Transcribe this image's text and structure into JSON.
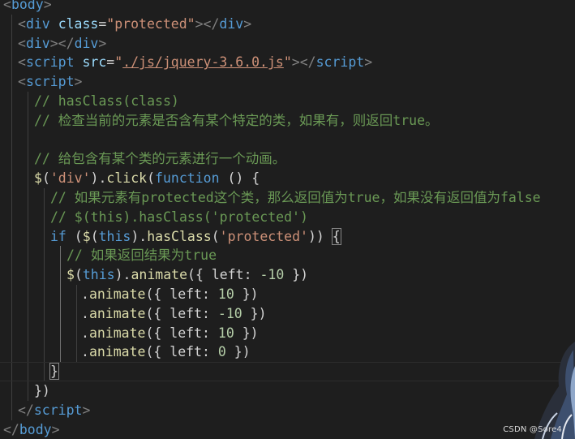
{
  "code": {
    "lines": [
      [
        {
          "c": "punct",
          "t": "<"
        },
        {
          "c": "tag",
          "t": "body"
        },
        {
          "c": "punct",
          "t": ">"
        }
      ],
      [
        {
          "c": "punct",
          "t": "<"
        },
        {
          "c": "tag",
          "t": "div"
        },
        {
          "c": "plain",
          "t": " "
        },
        {
          "c": "attr",
          "t": "class"
        },
        {
          "c": "plain",
          "t": "="
        },
        {
          "c": "str",
          "t": "\"protected\""
        },
        {
          "c": "punct",
          "t": "></"
        },
        {
          "c": "tag",
          "t": "div"
        },
        {
          "c": "punct",
          "t": ">"
        }
      ],
      [
        {
          "c": "punct",
          "t": "<"
        },
        {
          "c": "tag",
          "t": "div"
        },
        {
          "c": "punct",
          "t": "></"
        },
        {
          "c": "tag",
          "t": "div"
        },
        {
          "c": "punct",
          "t": ">"
        }
      ],
      [
        {
          "c": "punct",
          "t": "<"
        },
        {
          "c": "tag",
          "t": "script"
        },
        {
          "c": "plain",
          "t": " "
        },
        {
          "c": "attr",
          "t": "src"
        },
        {
          "c": "plain",
          "t": "="
        },
        {
          "c": "str",
          "t": "\""
        },
        {
          "c": "str link",
          "t": "./js/jquery-3.6.0.js"
        },
        {
          "c": "str",
          "t": "\""
        },
        {
          "c": "punct",
          "t": "></"
        },
        {
          "c": "tag",
          "t": "script"
        },
        {
          "c": "punct",
          "t": ">"
        }
      ],
      [
        {
          "c": "punct",
          "t": "<"
        },
        {
          "c": "tag",
          "t": "script"
        },
        {
          "c": "punct",
          "t": ">"
        }
      ],
      [
        {
          "c": "com",
          "t": "// hasClass(class)"
        }
      ],
      [
        {
          "c": "com",
          "t": "// 检查当前的元素是否含有某个特定的类，如果有，则返回true。"
        }
      ],
      [],
      [
        {
          "c": "com",
          "t": "// 给包含有某个类的元素进行一个动画。"
        }
      ],
      [
        {
          "c": "fn",
          "t": "$"
        },
        {
          "c": "plain",
          "t": "("
        },
        {
          "c": "str",
          "t": "'div'"
        },
        {
          "c": "plain",
          "t": ")."
        },
        {
          "c": "fn",
          "t": "click"
        },
        {
          "c": "plain",
          "t": "("
        },
        {
          "c": "kw",
          "t": "function"
        },
        {
          "c": "plain",
          "t": " () {"
        }
      ],
      [
        {
          "c": "com",
          "t": "// 如果元素有protected这个类，那么返回值为true，如果没有返回值为false"
        }
      ],
      [
        {
          "c": "com",
          "t": "// $(this).hasClass('protected')"
        }
      ],
      [
        {
          "c": "kw",
          "t": "if"
        },
        {
          "c": "plain",
          "t": " ("
        },
        {
          "c": "fn",
          "t": "$"
        },
        {
          "c": "plain",
          "t": "("
        },
        {
          "c": "kw",
          "t": "this"
        },
        {
          "c": "plain",
          "t": ")."
        },
        {
          "c": "fn",
          "t": "hasClass"
        },
        {
          "c": "plain",
          "t": "("
        },
        {
          "c": "str",
          "t": "'protected'"
        },
        {
          "c": "plain",
          "t": ")) "
        },
        {
          "c": "plain bracket-match",
          "t": "{"
        }
      ],
      [
        {
          "c": "com",
          "t": "// 如果返回结果为true"
        }
      ],
      [
        {
          "c": "fn",
          "t": "$"
        },
        {
          "c": "plain",
          "t": "("
        },
        {
          "c": "kw",
          "t": "this"
        },
        {
          "c": "plain",
          "t": ")."
        },
        {
          "c": "fn",
          "t": "animate"
        },
        {
          "c": "plain",
          "t": "({ left: "
        },
        {
          "c": "num",
          "t": "-10"
        },
        {
          "c": "plain",
          "t": " })"
        }
      ],
      [
        {
          "c": "plain",
          "t": "."
        },
        {
          "c": "fn",
          "t": "animate"
        },
        {
          "c": "plain",
          "t": "({ left: "
        },
        {
          "c": "num",
          "t": "10"
        },
        {
          "c": "plain",
          "t": " })"
        }
      ],
      [
        {
          "c": "plain",
          "t": "."
        },
        {
          "c": "fn",
          "t": "animate"
        },
        {
          "c": "plain",
          "t": "({ left: "
        },
        {
          "c": "num",
          "t": "-10"
        },
        {
          "c": "plain",
          "t": " })"
        }
      ],
      [
        {
          "c": "plain",
          "t": "."
        },
        {
          "c": "fn",
          "t": "animate"
        },
        {
          "c": "plain",
          "t": "({ left: "
        },
        {
          "c": "num",
          "t": "10"
        },
        {
          "c": "plain",
          "t": " })"
        }
      ],
      [
        {
          "c": "plain",
          "t": "."
        },
        {
          "c": "fn",
          "t": "animate"
        },
        {
          "c": "plain",
          "t": "({ left: "
        },
        {
          "c": "num",
          "t": "0"
        },
        {
          "c": "plain",
          "t": " })"
        }
      ],
      [
        {
          "c": "plain bracket-match",
          "t": "}"
        }
      ],
      [
        {
          "c": "plain",
          "t": "})"
        }
      ],
      [
        {
          "c": "punct",
          "t": "</"
        },
        {
          "c": "tag",
          "t": "script"
        },
        {
          "c": "punct",
          "t": ">"
        }
      ],
      [
        {
          "c": "punct",
          "t": "</"
        },
        {
          "c": "tag",
          "t": "body"
        },
        {
          "c": "punct",
          "t": ">"
        }
      ]
    ]
  },
  "theme": {
    "background": "#1e1e1e",
    "tag": "#569cd6",
    "string": "#ce9178",
    "comment": "#6a9955",
    "function": "#dcdcaa",
    "number": "#b5cea8",
    "attribute": "#9cdcfe"
  },
  "watermark": "CSDN @Sore4"
}
